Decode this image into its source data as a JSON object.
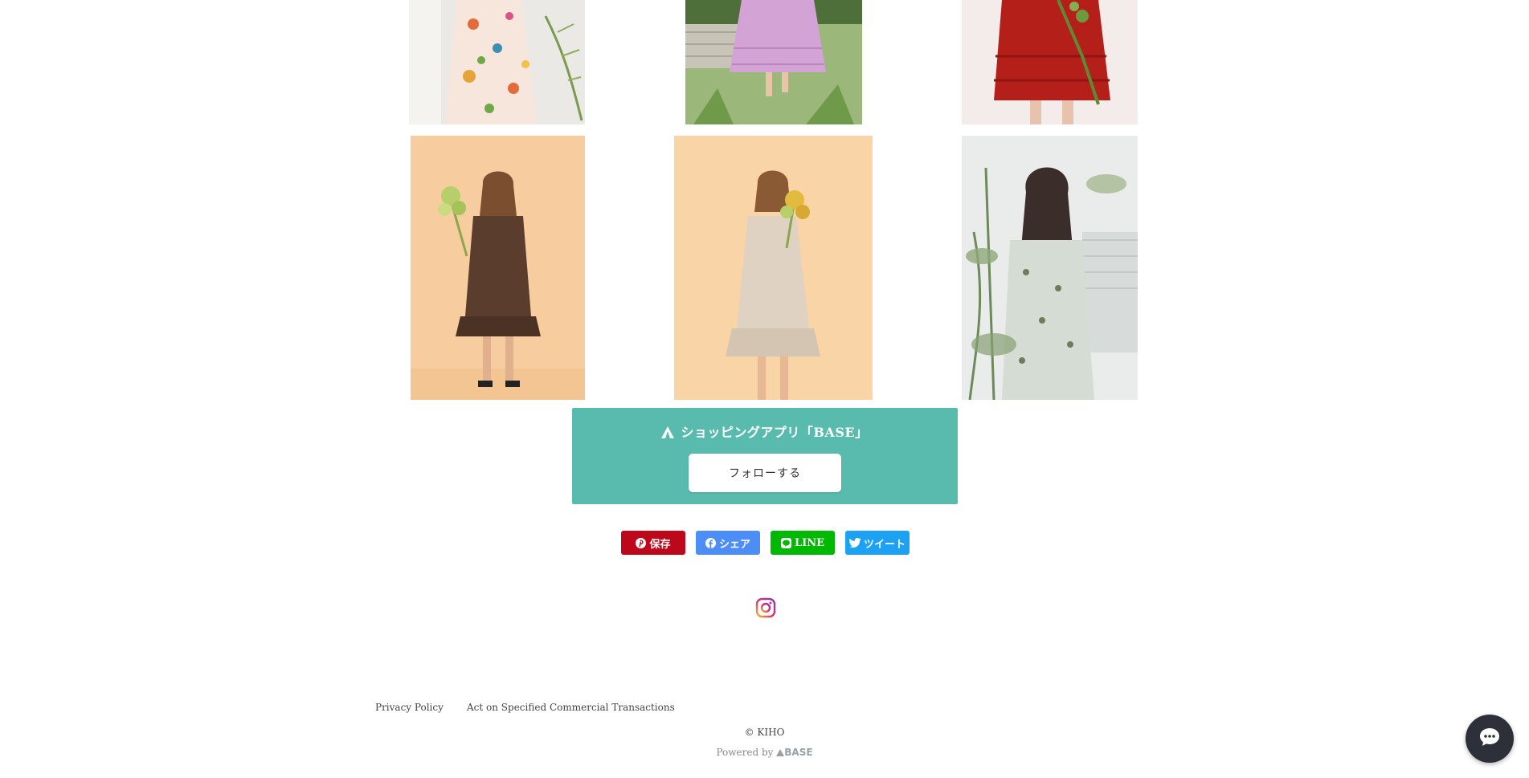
{
  "products": [
    {
      "name": "floral-maxi-dress",
      "colors": {
        "bg": "#eceae6",
        "garment": "#f4d9c8",
        "accent": "#e46a3c"
      }
    },
    {
      "name": "lilac-tiered-skirt",
      "colors": {
        "bg": "#8fae6a",
        "garment": "#d8a9d8",
        "accent": "#e6d0a2"
      }
    },
    {
      "name": "red-ruffle-top",
      "colors": {
        "bg": "#f4eeec",
        "garment": "#b8221c",
        "accent": "#6a8a3a"
      }
    },
    {
      "name": "brown-ruffle-dress",
      "colors": {
        "bg": "#f6cfa0",
        "garment": "#5b3f2e",
        "accent": "#9fbe5a"
      }
    },
    {
      "name": "beige-ruffle-dress",
      "colors": {
        "bg": "#f8d3a4",
        "garment": "#e2d3c3",
        "accent": "#d8b24a"
      }
    },
    {
      "name": "floral-print-blouse",
      "colors": {
        "bg": "#dfe3e2",
        "garment": "#d7dcd6",
        "accent": "#5f7a55"
      }
    }
  ],
  "app_banner": {
    "title": "ショッピングアプリ「BASE」",
    "follow_label": "フォローする",
    "color": "#58bbae"
  },
  "share": {
    "pinterest": "保存",
    "facebook": "シェア",
    "line": "LINE",
    "twitter": "ツイート"
  },
  "social": {
    "instagram_icon": "instagram-icon"
  },
  "footer": {
    "privacy": "Privacy Policy",
    "act": "Act on Specified Commercial Transactions",
    "copyright": "© KIHO",
    "powered_by": "Powered by",
    "base_logo": "BASE"
  },
  "chat": {
    "icon": "chat-bubble-icon"
  }
}
